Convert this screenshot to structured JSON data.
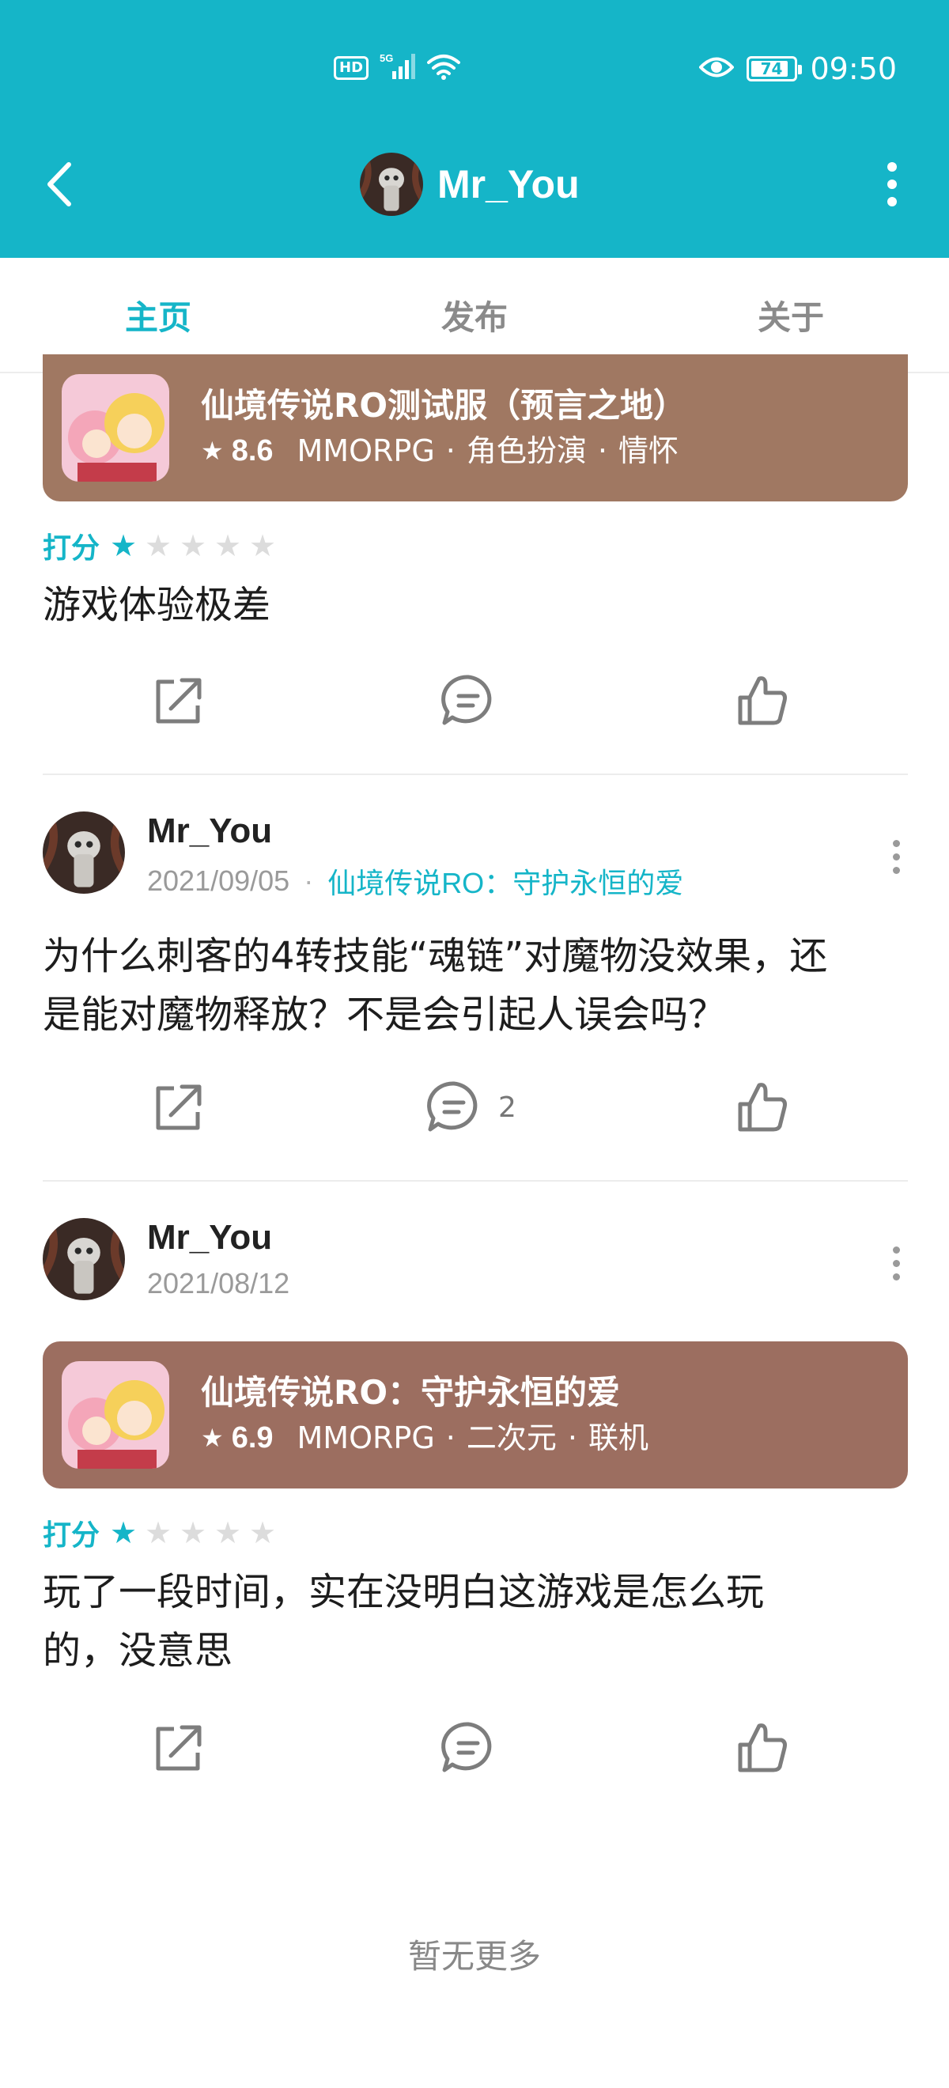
{
  "status_bar": {
    "hd": "HD",
    "network": "5G",
    "battery": "74",
    "time": "09:50"
  },
  "header": {
    "title": "Mr_You"
  },
  "tabs": [
    {
      "label": "主页",
      "active": true
    },
    {
      "label": "发布",
      "active": false
    },
    {
      "label": "关于",
      "active": false
    }
  ],
  "posts": [
    {
      "game_card": {
        "title": "仙境传说RO测试服（预言之地）",
        "score": "8.6",
        "tags": [
          "MMORPG",
          "角色扮演",
          "情怀"
        ],
        "bg_color": "#a07862"
      },
      "rating_label": "打分",
      "stars": 1,
      "text": "游戏体验极差",
      "comments": ""
    },
    {
      "author": "Mr_You",
      "date": "2021/09/05",
      "game_link": "仙境传说RO：守护永恒的爱",
      "text_line1": "为什么刺客的4转技能“魂链”对魔物没效果，还",
      "text_line2": "是能对魔物释放？不是会引起人误会吗？",
      "comments": "2"
    },
    {
      "author": "Mr_You",
      "date": "2021/08/12",
      "game_card": {
        "title": "仙境传说RO：守护永恒的爱",
        "score": "6.9",
        "tags": [
          "MMORPG",
          "二次元",
          "联机"
        ],
        "bg_color": "#9c6e60"
      },
      "rating_label": "打分",
      "stars": 1,
      "text_line1": "玩了一段时间，实在没明白这游戏是怎么玩",
      "text_line2": "的，没意思",
      "comments": ""
    }
  ],
  "footer": {
    "end_text": "暂无更多"
  },
  "colors": {
    "accent": "#15b5c8",
    "star_off": "#dcdcdc"
  }
}
